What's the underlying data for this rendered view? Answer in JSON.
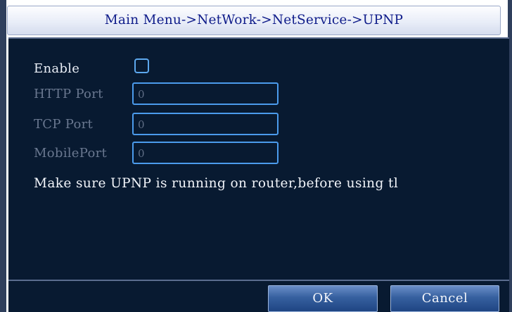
{
  "window": {
    "title": "Main Menu->NetWork->NetService->UPNP"
  },
  "form": {
    "enable_label": "Enable",
    "enable_checked": false,
    "http_port_label": "HTTP Port",
    "http_port_value": "0",
    "tcp_port_label": "TCP Port",
    "tcp_port_value": "0",
    "mobile_port_label": "MobilePort",
    "mobile_port_value": "0"
  },
  "note": "Make sure UPNP is running on router,before using tl",
  "buttons": {
    "ok": "OK",
    "cancel": "Cancel"
  },
  "colors": {
    "panel_background": "#081a31",
    "field_border": "#4b9bec",
    "title_text": "#0f1c8a"
  }
}
